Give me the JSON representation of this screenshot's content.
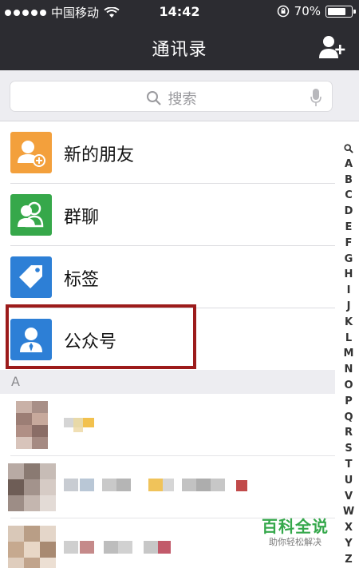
{
  "status_bar": {
    "carrier": "中国移动",
    "time": "14:42",
    "battery": "70%",
    "battery_level": 0.7
  },
  "nav": {
    "title": "通讯录",
    "right_icon": "add-contact-icon"
  },
  "search": {
    "placeholder": "搜索",
    "left_icon": "search-icon",
    "right_icon": "microphone-icon"
  },
  "functions": [
    {
      "label": "新的朋友",
      "icon": "new-friend-icon",
      "color": "#f3a03c"
    },
    {
      "label": "群聊",
      "icon": "group-chat-icon",
      "color": "#36a84a"
    },
    {
      "label": "标签",
      "icon": "tag-icon",
      "color": "#2d7fd6"
    },
    {
      "label": "公众号",
      "icon": "official-account-icon",
      "color": "#2d7fd6"
    }
  ],
  "section_header": "A",
  "index_letters": [
    "🔍",
    "A",
    "B",
    "C",
    "D",
    "E",
    "F",
    "G",
    "H",
    "I",
    "J",
    "K",
    "L",
    "M",
    "N",
    "O",
    "P",
    "Q",
    "R",
    "S",
    "T",
    "U",
    "V",
    "W",
    "X",
    "Y",
    "Z",
    "#"
  ],
  "watermark": {
    "title": "百科全说",
    "subtitle": "助你轻松解决"
  },
  "colors": {
    "header_bg": "#2c2c31",
    "highlight_border": "#9c1b1b",
    "watermark_green": "#35a84b"
  }
}
